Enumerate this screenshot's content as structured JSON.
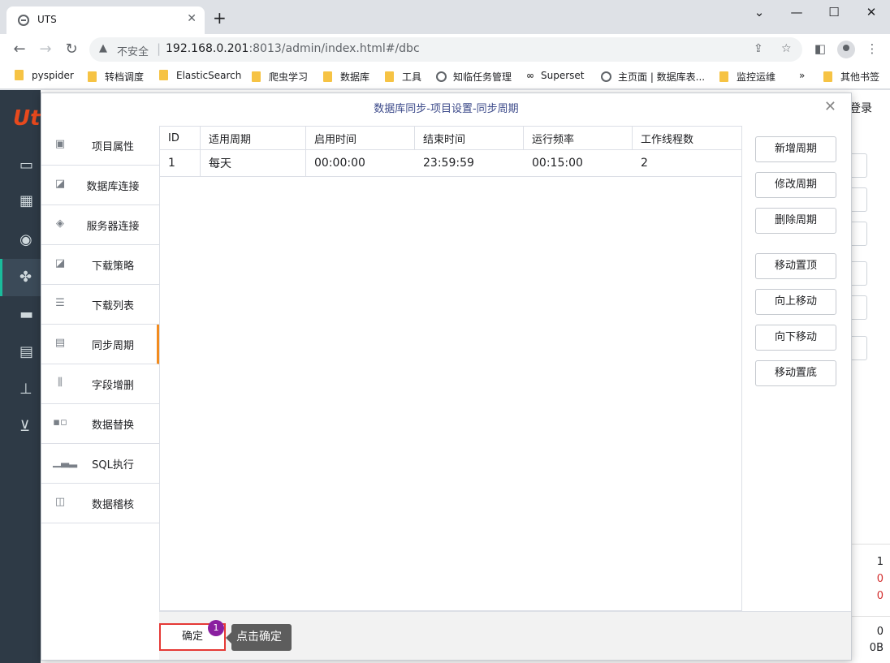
{
  "browser": {
    "tab_title": "UTS",
    "insecure_label": "不安全",
    "url_host": "192.168.0.201",
    "url_rest": ":8013/admin/index.html#/dbc",
    "bookmarks": [
      "pyspider",
      "转档调度",
      "ElasticSearch",
      "爬虫学习",
      "数据库",
      "工具",
      "知临任务管理",
      "Superset",
      "主页面 | 数据库表...",
      "监控运维"
    ],
    "bookmarks_more": "»",
    "other_bookmarks": "其他书签"
  },
  "background": {
    "login_label": "登录",
    "numbers": [
      "1",
      "0",
      "0",
      "0",
      "0B"
    ]
  },
  "dialog": {
    "title": "数据库同步-项目设置-同步周期",
    "menu": [
      {
        "label": "项目属性",
        "icon": "id-card-icon"
      },
      {
        "label": "数据库连接",
        "icon": "chart-search-icon"
      },
      {
        "label": "服务器连接",
        "icon": "layers-icon"
      },
      {
        "label": "下载策略",
        "icon": "chart-search-icon"
      },
      {
        "label": "下载列表",
        "icon": "list-icon"
      },
      {
        "label": "同步周期",
        "icon": "document-clock-icon",
        "active": true
      },
      {
        "label": "字段增删",
        "icon": "columns-icon"
      },
      {
        "label": "数据替换",
        "icon": "replace-icon"
      },
      {
        "label": "SQL执行",
        "icon": "bar-chart-icon"
      },
      {
        "label": "数据稽核",
        "icon": "monitor-chart-icon"
      }
    ],
    "table": {
      "columns": [
        "ID",
        "适用周期",
        "启用时间",
        "结束时间",
        "运行频率",
        "工作线程数"
      ],
      "rows": [
        [
          "1",
          "每天",
          "00:00:00",
          "23:59:59",
          "00:15:00",
          "2"
        ]
      ]
    },
    "buttons": [
      "新增周期",
      "修改周期",
      "删除周期",
      "移动置顶",
      "向上移动",
      "向下移动",
      "移动置底"
    ],
    "ok_label": "确定",
    "step_badge": "1",
    "tooltip": "点击确定"
  },
  "colors": {
    "active_marker": "#f28b1e",
    "highlight_border": "#e53935",
    "badge": "#8a1fa0",
    "sidebar": "#2e3a46"
  }
}
